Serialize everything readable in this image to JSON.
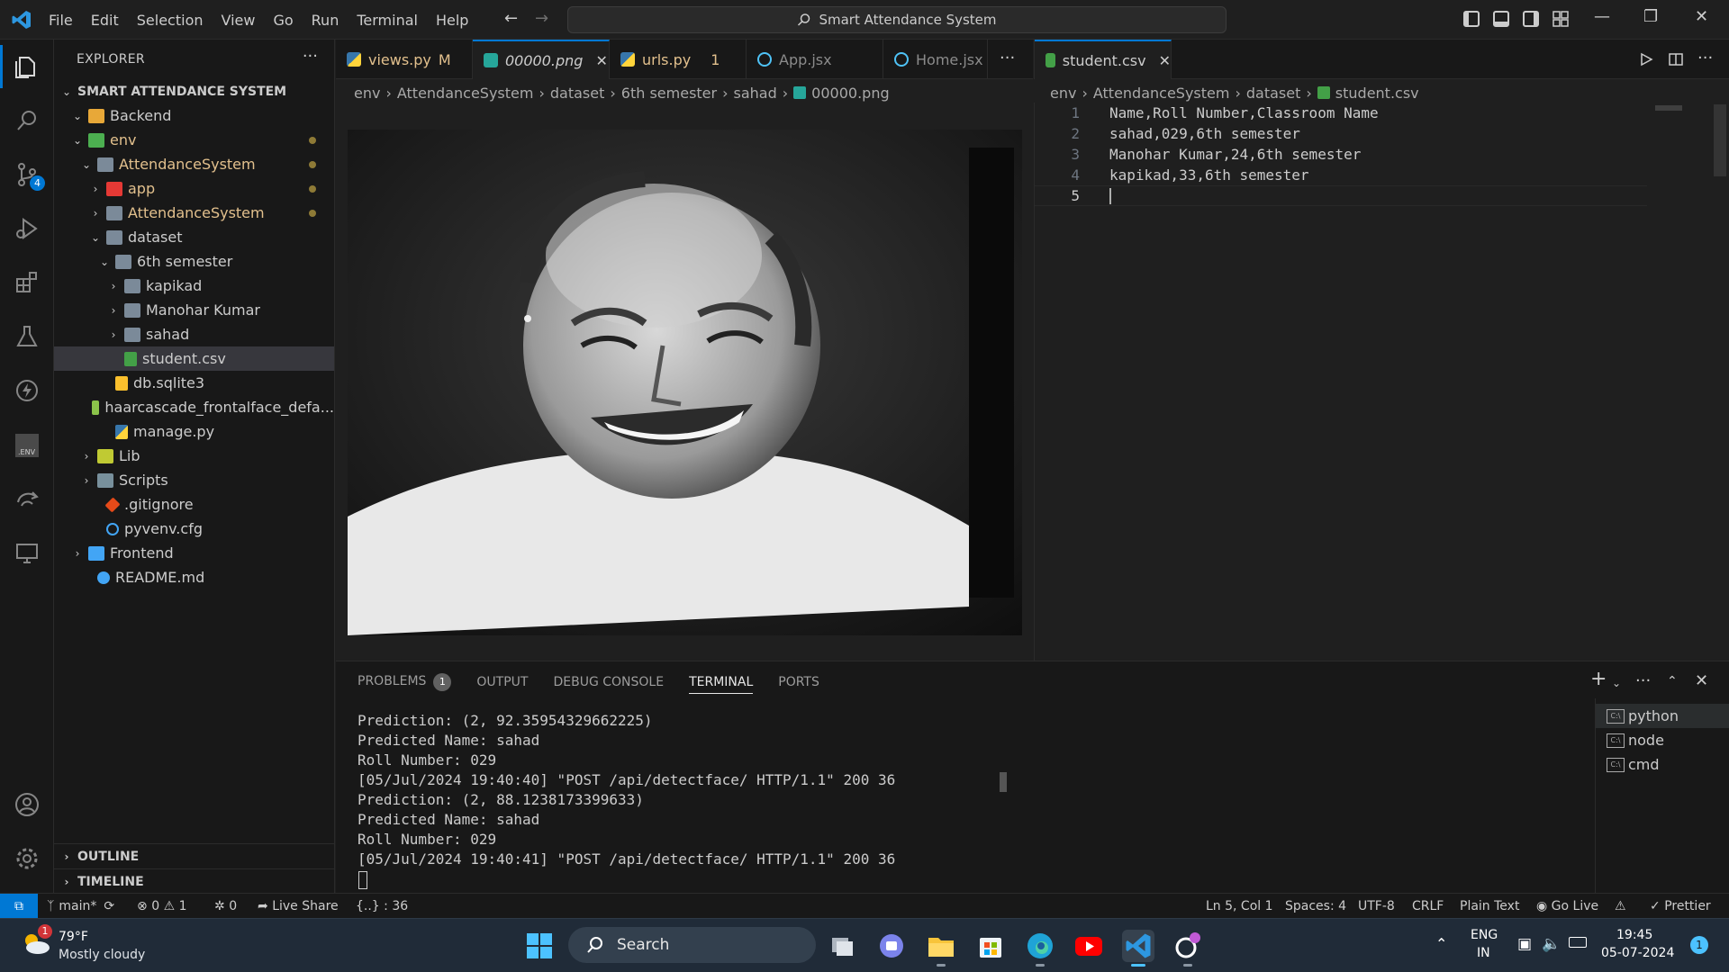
{
  "window": {
    "menu": [
      "File",
      "Edit",
      "Selection",
      "View",
      "Go",
      "Run",
      "Terminal",
      "Help"
    ],
    "search_title": "Smart Attendance System"
  },
  "activity": {
    "scm_badge": "4"
  },
  "explorer": {
    "title": "EXPLORER",
    "root": "SMART ATTENDANCE SYSTEM",
    "items": [
      {
        "label": "Backend"
      },
      {
        "label": "env"
      },
      {
        "label": "AttendanceSystem"
      },
      {
        "label": "app"
      },
      {
        "label": "AttendanceSystem"
      },
      {
        "label": "dataset"
      },
      {
        "label": "6th semester"
      },
      {
        "label": "kapikad"
      },
      {
        "label": "Manohar Kumar"
      },
      {
        "label": "sahad"
      },
      {
        "label": "student.csv"
      },
      {
        "label": "db.sqlite3"
      },
      {
        "label": "haarcascade_frontalface_defa..."
      },
      {
        "label": "manage.py"
      },
      {
        "label": "Lib"
      },
      {
        "label": "Scripts"
      },
      {
        "label": ".gitignore"
      },
      {
        "label": "pyvenv.cfg"
      },
      {
        "label": "Frontend"
      },
      {
        "label": "README.md"
      }
    ],
    "outline": "OUTLINE",
    "timeline": "TIMELINE"
  },
  "editor1": {
    "tabs": [
      {
        "label": "views.py",
        "flag": "M"
      },
      {
        "label": "00000.png"
      },
      {
        "label": "urls.py",
        "flag": "1"
      },
      {
        "label": "App.jsx"
      },
      {
        "label": "Home.jsx"
      }
    ],
    "breadcrumb": [
      "env",
      "AttendanceSystem",
      "dataset",
      "6th semester",
      "sahad",
      "00000.png"
    ]
  },
  "editor2": {
    "tab": "student.csv",
    "breadcrumb": [
      "env",
      "AttendanceSystem",
      "dataset",
      "student.csv"
    ],
    "lines": [
      {
        "n": "1",
        "text": "Name,Roll Number,Classroom Name"
      },
      {
        "n": "2",
        "text": "sahad,029,6th semester"
      },
      {
        "n": "3",
        "text": "Manohar Kumar,24,6th semester"
      },
      {
        "n": "4",
        "text": "kapikad,33,6th semester"
      },
      {
        "n": "5",
        "text": ""
      }
    ]
  },
  "panel": {
    "tabs": [
      "PROBLEMS",
      "OUTPUT",
      "DEBUG CONSOLE",
      "TERMINAL",
      "PORTS"
    ],
    "problems_badge": "1",
    "terminal_lines": [
      "Prediction: (2, 92.35954329662225)",
      "Predicted Name: sahad",
      "Roll Number: 029",
      "[05/Jul/2024 19:40:40] \"POST /api/detectface/ HTTP/1.1\" 200 36",
      "Prediction: (2, 88.1238173399633)",
      "Predicted Name: sahad",
      "Roll Number: 029",
      "[05/Jul/2024 19:40:41] \"POST /api/detectface/ HTTP/1.1\" 200 36"
    ],
    "terminals": [
      "python",
      "node",
      "cmd"
    ]
  },
  "statusbar": {
    "branch": "main*",
    "errors": "0",
    "warnings": "1",
    "ports": "0",
    "live_share": "Live Share",
    "json_path": "{..} : 36",
    "position": "Ln 5, Col 1",
    "spaces": "Spaces: 4",
    "encoding": "UTF-8",
    "eol": "CRLF",
    "language": "Plain Text",
    "go_live": "Go Live",
    "prettier": "Prettier"
  },
  "taskbar": {
    "temp": "79°F",
    "weather": "Mostly cloudy",
    "weather_badge": "1",
    "search": "Search",
    "lang_top": "ENG",
    "lang_bottom": "IN",
    "time": "19:45",
    "date": "05-07-2024",
    "notif": "1"
  },
  "colors": {
    "accent": "#0078d4",
    "modified": "#e2c08d",
    "bg": "#1f1f1f",
    "sidebar": "#181818"
  }
}
